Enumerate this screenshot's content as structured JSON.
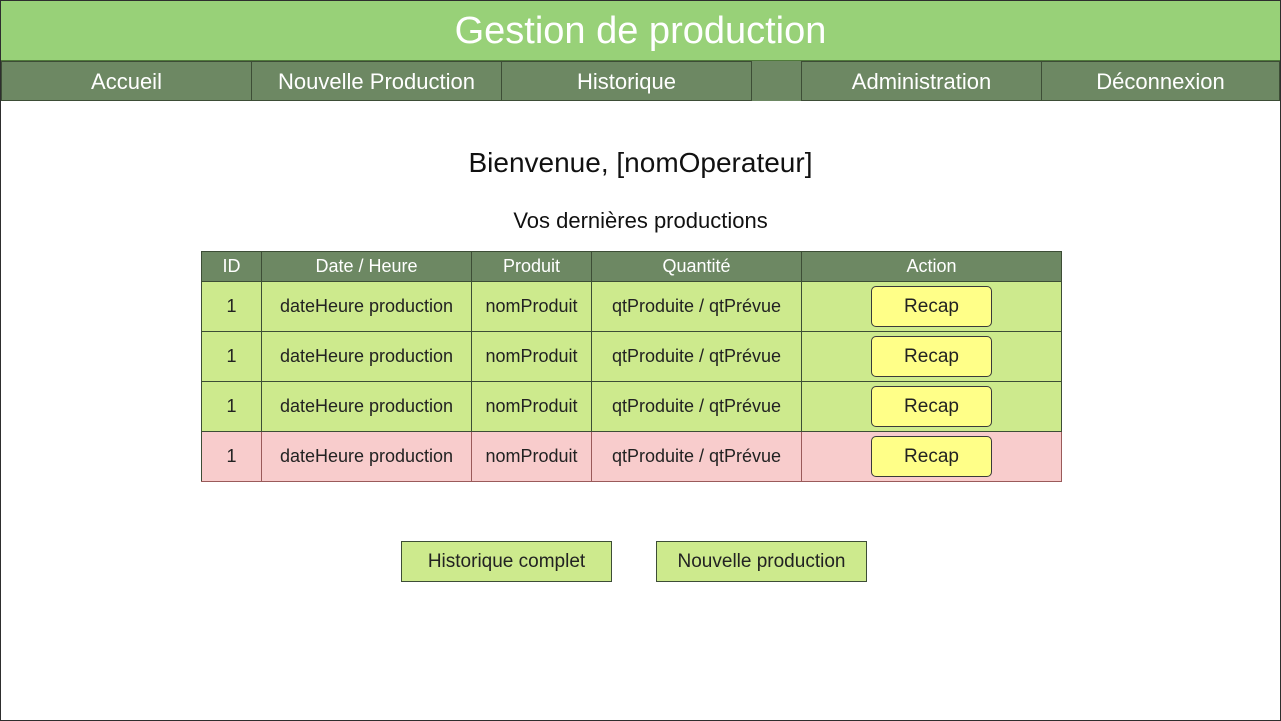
{
  "header": {
    "title": "Gestion de production"
  },
  "nav": {
    "items": [
      {
        "label": "Accueil"
      },
      {
        "label": "Nouvelle Production"
      },
      {
        "label": "Historique"
      },
      {
        "label": "Administration"
      },
      {
        "label": "Déconnexion"
      }
    ]
  },
  "main": {
    "welcome": "Bienvenue, [nomOperateur]",
    "subtitle": "Vos dernières productions",
    "table": {
      "headers": [
        "ID",
        "Date / Heure",
        "Produit",
        "Quantité",
        "Action"
      ],
      "rows": [
        {
          "id": "1",
          "date": "dateHeure production",
          "product": "nomProduit",
          "qty": "qtProduite / qtPrévue",
          "action": "Recap",
          "status": "ok"
        },
        {
          "id": "1",
          "date": "dateHeure production",
          "product": "nomProduit",
          "qty": "qtProduite / qtPrévue",
          "action": "Recap",
          "status": "ok"
        },
        {
          "id": "1",
          "date": "dateHeure production",
          "product": "nomProduit",
          "qty": "qtProduite / qtPrévue",
          "action": "Recap",
          "status": "ok"
        },
        {
          "id": "1",
          "date": "dateHeure production",
          "product": "nomProduit",
          "qty": "qtProduite / qtPrévue",
          "action": "Recap",
          "status": "ko"
        }
      ]
    },
    "buttons": {
      "history": "Historique complet",
      "new_production": "Nouvelle production"
    }
  },
  "colors": {
    "title_bar": "#98d178",
    "nav_bar": "#6d8863",
    "row_ok": "#cdea8d",
    "row_ko": "#f8cccc",
    "recap_button": "#ffff88"
  }
}
